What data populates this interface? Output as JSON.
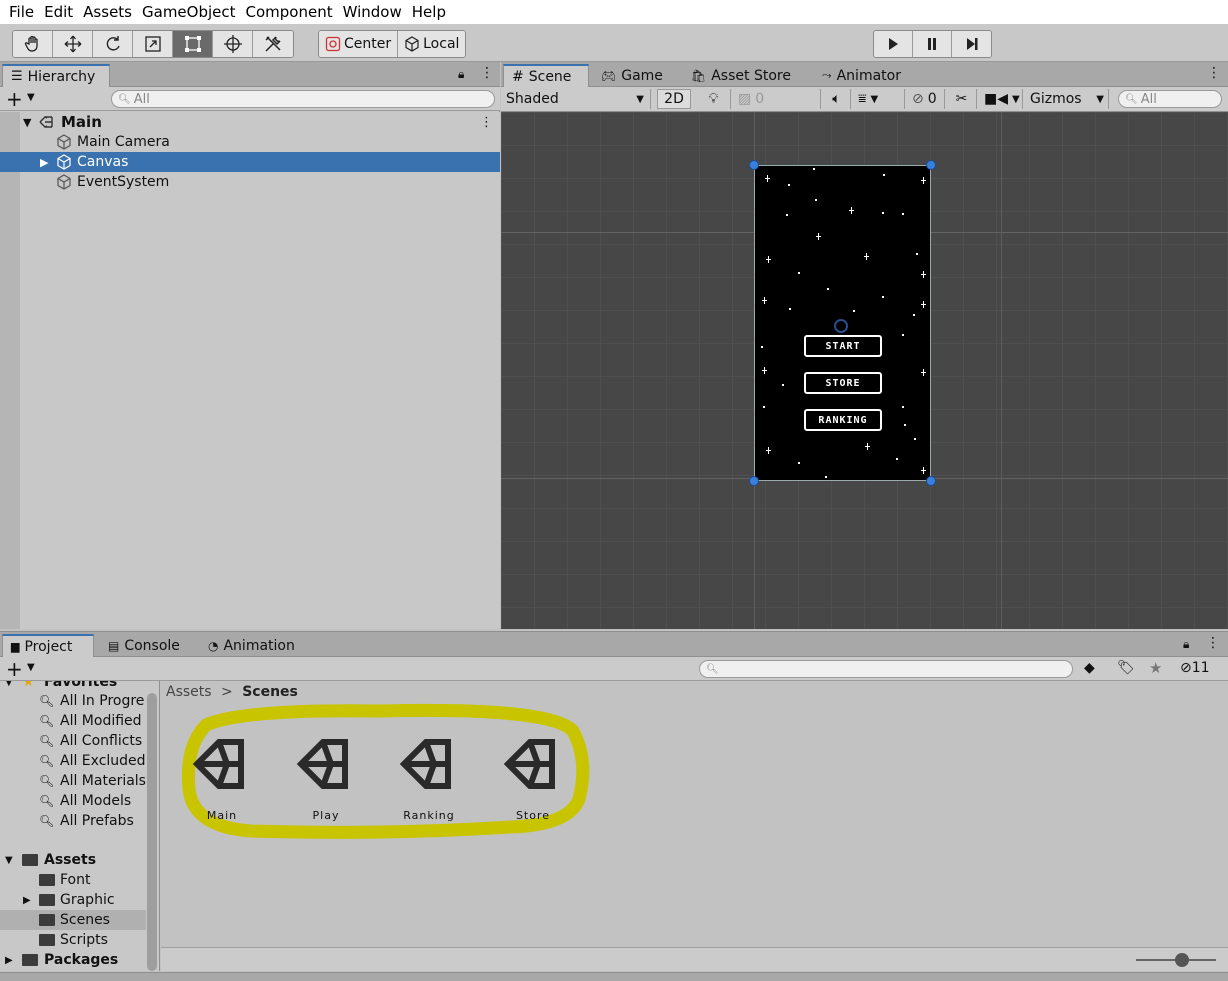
{
  "menu": [
    "File",
    "Edit",
    "Assets",
    "GameObject",
    "Component",
    "Window",
    "Help"
  ],
  "toolbar": {
    "tools": [
      "hand-icon",
      "move-icon",
      "rotate-icon",
      "scale-icon",
      "rect-icon",
      "transform-icon",
      "custom-tools-icon"
    ],
    "pivot_label": "Center",
    "space_label": "Local",
    "play": [
      "play-icon",
      "pause-icon",
      "step-icon"
    ]
  },
  "hierarchy": {
    "tab": "Hierarchy",
    "search_placeholder": "All",
    "scene_name": "Main",
    "items": [
      "Main Camera",
      "Canvas",
      "EventSystem"
    ]
  },
  "scene_view": {
    "tabs": [
      "Scene",
      "Game",
      "Asset Store",
      "Animator"
    ],
    "shading": "Shaded",
    "mode_2d": "2D",
    "fx_count": "0",
    "hidden_count": "0",
    "gizmos": "Gizmos",
    "search_placeholder": "All",
    "buttons": [
      "START",
      "STORE",
      "RANKING"
    ]
  },
  "project": {
    "tabs": [
      "Project",
      "Console",
      "Animation"
    ],
    "hidden_count": "11",
    "favorites_label": "Favorites",
    "favorites": [
      "All In Progre",
      "All Modified",
      "All Conflicts",
      "All Excluded",
      "All Materials",
      "All Models",
      "All Prefabs"
    ],
    "assets_label": "Assets",
    "asset_folders": [
      "Font",
      "Graphic",
      "Scenes",
      "Scripts"
    ],
    "packages_label": "Packages",
    "breadcrumb": [
      "Assets",
      "Scenes"
    ],
    "scenes": [
      "Main",
      "Play",
      "Ranking",
      "Store"
    ],
    "highlight_color": "#c8c400"
  }
}
